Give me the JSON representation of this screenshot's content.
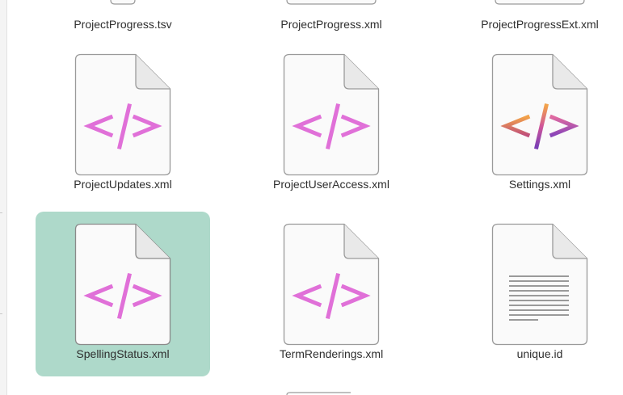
{
  "files": [
    {
      "name": "ProjectProgress.tsv",
      "icon": "text-document-icon",
      "partial": true
    },
    {
      "name": "ProjectProgress.xml",
      "icon": "xml-document-icon",
      "partial": true
    },
    {
      "name": "ProjectProgressExt.xml",
      "icon": "xml-document-icon",
      "partial": true
    },
    {
      "name": "ProjectUpdates.xml",
      "icon": "xml-document-icon",
      "selected": false
    },
    {
      "name": "ProjectUserAccess.xml",
      "icon": "xml-document-icon",
      "selected": false
    },
    {
      "name": "Settings.xml",
      "icon": "xml-settings-document-icon",
      "selected": false
    },
    {
      "name": "SpellingStatus.xml",
      "icon": "xml-document-icon",
      "selected": true
    },
    {
      "name": "TermRenderings.xml",
      "icon": "xml-document-icon",
      "selected": false
    },
    {
      "name": "unique.id",
      "icon": "text-document-icon",
      "selected": false
    }
  ],
  "colors": {
    "selection": "#aed9ca",
    "xml_glyph": "#e070d8",
    "settings_glyph_gradient": [
      "#f2a24a",
      "#c05ac0",
      "#7a3fb5"
    ],
    "page_fill": "#fafafa",
    "page_border": "#9a9a9a"
  }
}
